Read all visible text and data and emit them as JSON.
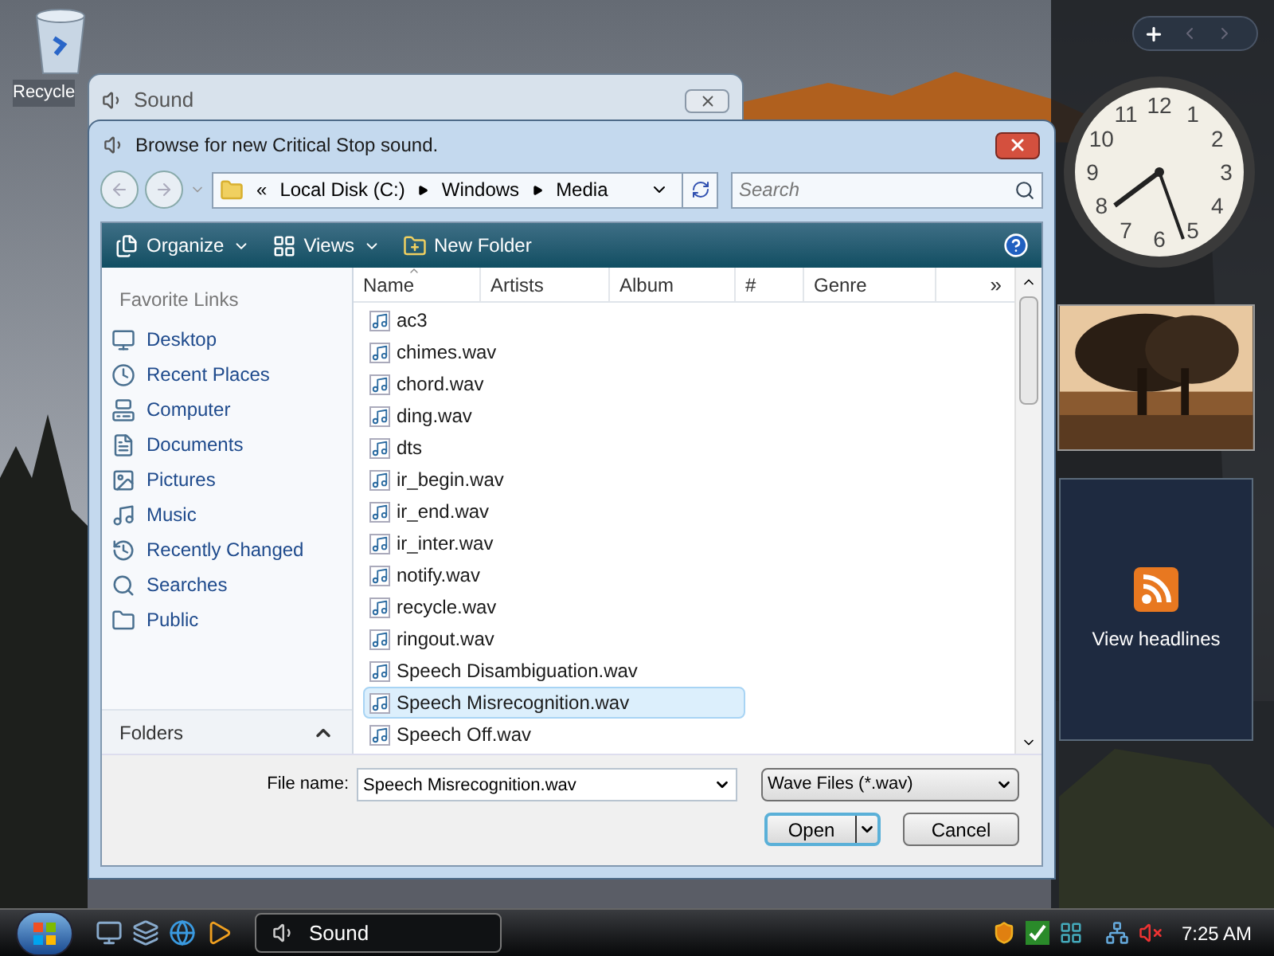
{
  "desktop": {
    "icons": [
      {
        "label": "Recycle"
      }
    ]
  },
  "background_window": {
    "title": "Sound"
  },
  "dialog": {
    "title": "Browse for new Critical Stop sound.",
    "breadcrumb": [
      "«",
      "Local Disk (C:)",
      "Windows",
      "Media"
    ],
    "search": {
      "placeholder": "Search"
    },
    "toolbar": [
      {
        "label": "Organize",
        "kind": "menu"
      },
      {
        "label": "Views",
        "kind": "menu"
      },
      {
        "label": "New Folder",
        "kind": "button"
      }
    ],
    "favorite_links": {
      "heading": "Favorite Links",
      "items": [
        {
          "label": "Desktop"
        },
        {
          "label": "Recent Places"
        },
        {
          "label": "Computer"
        },
        {
          "label": "Documents"
        },
        {
          "label": "Pictures"
        },
        {
          "label": "Music"
        },
        {
          "label": "Recently Changed"
        },
        {
          "label": "Searches"
        },
        {
          "label": "Public"
        }
      ]
    },
    "folders": {
      "label": "Folders",
      "expanded": false
    },
    "columns": [
      {
        "label": "Name",
        "sorted": true
      },
      {
        "label": "Artists",
        "sorted": false
      },
      {
        "label": "Album",
        "sorted": false
      },
      {
        "label": "#",
        "sorted": false
      },
      {
        "label": "Genre",
        "sorted": false
      }
    ],
    "more_columns": "»",
    "files": [
      {
        "name": "ac3",
        "selected": false
      },
      {
        "name": "chimes.wav",
        "selected": false
      },
      {
        "name": "chord.wav",
        "selected": false
      },
      {
        "name": "ding.wav",
        "selected": false
      },
      {
        "name": "dts",
        "selected": false
      },
      {
        "name": "ir_begin.wav",
        "selected": false
      },
      {
        "name": "ir_end.wav",
        "selected": false
      },
      {
        "name": "ir_inter.wav",
        "selected": false
      },
      {
        "name": "notify.wav",
        "selected": false
      },
      {
        "name": "recycle.wav",
        "selected": false
      },
      {
        "name": "ringout.wav",
        "selected": false
      },
      {
        "name": "Speech Disambiguation.wav",
        "selected": false
      },
      {
        "name": "Speech Misrecognition.wav",
        "selected": true
      },
      {
        "name": "Speech Off.wav",
        "selected": false
      }
    ],
    "file_name": {
      "label": "File name:",
      "value": "Speech Misrecognition.wav"
    },
    "file_type": "Wave Files (*.wav)",
    "buttons": [
      {
        "label": "Open",
        "kind": "split"
      },
      {
        "label": "Cancel",
        "kind": "plain"
      }
    ]
  },
  "sidebar": {
    "clock": {
      "numerals": [
        "12",
        "11",
        "1",
        "10",
        "2",
        "9",
        "3",
        "8",
        "4",
        "7",
        "5",
        "6"
      ]
    },
    "feed": {
      "label": "View headlines"
    }
  },
  "taskbar": {
    "tasks": [
      {
        "label": "Sound",
        "selected": true
      }
    ],
    "clock": "7:25 AM"
  }
}
